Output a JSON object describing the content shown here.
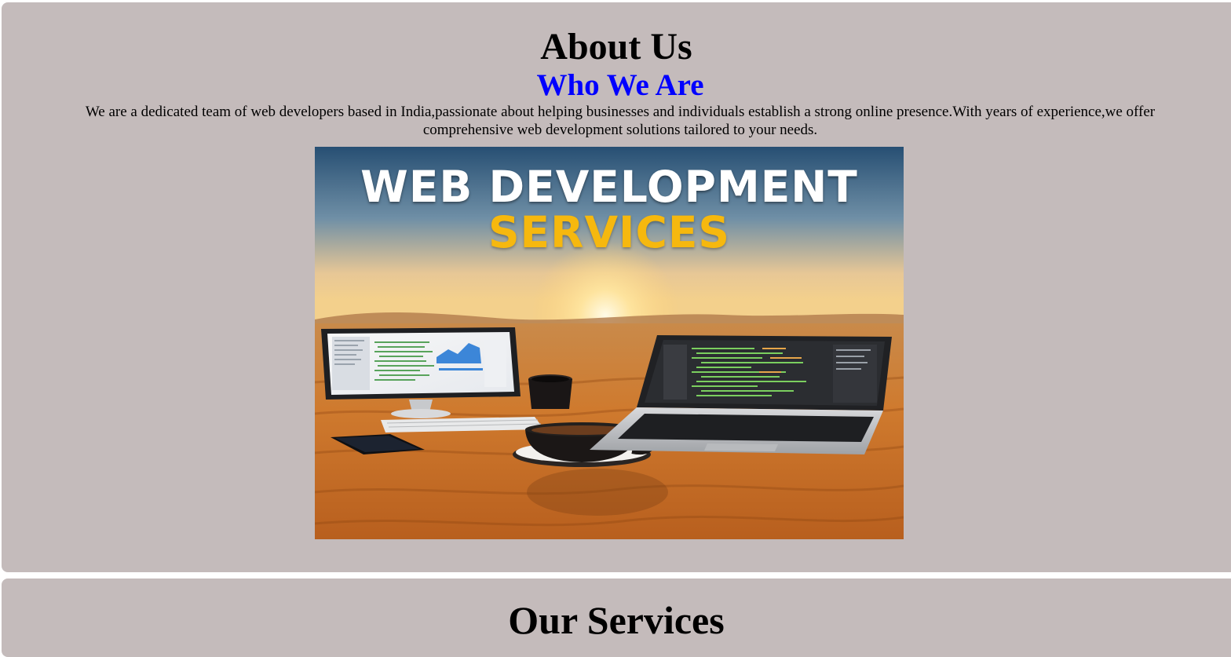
{
  "about": {
    "title": "About Us",
    "subtitle": "Who We Are",
    "description": "We are a dedicated team of web developers based in India,passionate about helping businesses and individuals establish a strong online presence.With years of experience,we offer comprehensive web development solutions tailored to your needs.",
    "image": {
      "headline": "WEB DEVELOPMENT",
      "subheadline": "SERVICES"
    }
  },
  "services": {
    "title": "Our Services"
  },
  "colors": {
    "section_background": "#c4bbbb",
    "subtitle": "#0000ff",
    "image_subheadline": "#f6b80e"
  }
}
